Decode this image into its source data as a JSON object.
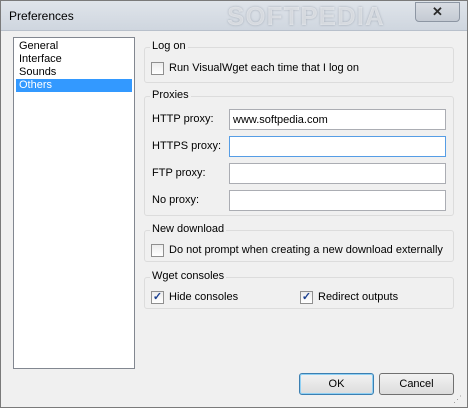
{
  "window": {
    "title": "Preferences",
    "watermark": "SOFTPEDIA",
    "close_glyph": "✕"
  },
  "sidebar": {
    "items": [
      {
        "label": "General",
        "selected": false
      },
      {
        "label": "Interface",
        "selected": false
      },
      {
        "label": "Sounds",
        "selected": false
      },
      {
        "label": "Others",
        "selected": true
      }
    ]
  },
  "logon": {
    "group_label": "Log on",
    "run_on_logon_label": "Run VisualWget each time that I log on",
    "run_on_logon_checked": false
  },
  "proxies": {
    "group_label": "Proxies",
    "http_label": "HTTP proxy:",
    "http_value": "www.softpedia.com",
    "https_label": "HTTPS proxy:",
    "https_value": "",
    "ftp_label": "FTP proxy:",
    "ftp_value": "",
    "noproxy_label": "No proxy:",
    "noproxy_value": ""
  },
  "new_download": {
    "group_label": "New download",
    "no_prompt_label": "Do not prompt when creating a new download externally",
    "no_prompt_checked": false
  },
  "wget_consoles": {
    "group_label": "Wget consoles",
    "hide_label": "Hide consoles",
    "hide_checked": true,
    "redirect_label": "Redirect outputs",
    "redirect_checked": true
  },
  "buttons": {
    "ok_label": "OK",
    "cancel_label": "Cancel"
  },
  "colors": {
    "selection": "#3399ff",
    "focus_border": "#569de5"
  },
  "icons": {
    "close": "close-icon",
    "check": "checkmark-icon",
    "grip": "resize-grip-icon"
  }
}
